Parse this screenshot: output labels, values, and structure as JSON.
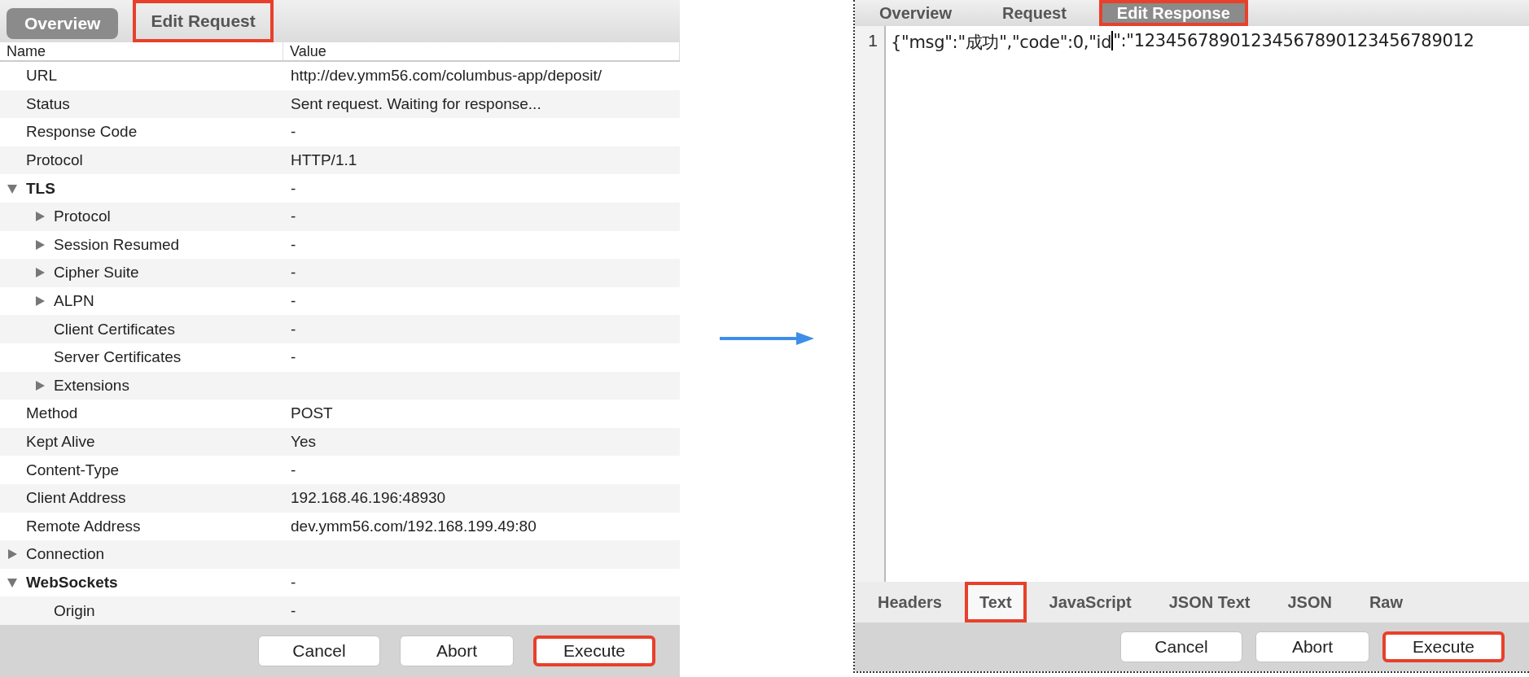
{
  "left_panel": {
    "tabs": [
      {
        "label": "Overview",
        "selected": true,
        "highlighted": false
      },
      {
        "label": "Edit Request",
        "selected": false,
        "highlighted": true
      }
    ],
    "columns": [
      "Name",
      "Value"
    ],
    "rows": [
      {
        "name": "URL",
        "value": "http://dev.ymm56.com/columbus-app/deposit/"
      },
      {
        "name": "Status",
        "value": "Sent request. Waiting for response..."
      },
      {
        "name": "Response Code",
        "value": "-"
      },
      {
        "name": "Protocol",
        "value": "HTTP/1.1"
      },
      {
        "name": "TLS",
        "value": "-",
        "expanded": true,
        "children": [
          {
            "name": "Protocol",
            "value": "-",
            "expanded": false
          },
          {
            "name": "Session Resumed",
            "value": "-",
            "expanded": false
          },
          {
            "name": "Cipher Suite",
            "value": "-",
            "expanded": false
          },
          {
            "name": "ALPN",
            "value": "-",
            "expanded": false
          },
          {
            "name": "Client Certificates",
            "value": "-"
          },
          {
            "name": "Server Certificates",
            "value": "-"
          },
          {
            "name": "Extensions",
            "expanded": false
          }
        ]
      },
      {
        "name": "Method",
        "value": "POST"
      },
      {
        "name": "Kept Alive",
        "value": "Yes"
      },
      {
        "name": "Content-Type",
        "value": "-"
      },
      {
        "name": "Client Address",
        "value": "192.168.46.196:48930"
      },
      {
        "name": "Remote Address",
        "value": "dev.ymm56.com/192.168.199.49:80"
      },
      {
        "name": "Connection",
        "expanded": false
      },
      {
        "name": "WebSockets",
        "value": "-",
        "expanded": true,
        "children": [
          {
            "name": "Origin",
            "value": "-"
          }
        ]
      }
    ],
    "buttons": [
      {
        "label": "Cancel",
        "highlighted": false
      },
      {
        "label": "Abort",
        "highlighted": false
      },
      {
        "label": "Execute",
        "highlighted": true
      }
    ]
  },
  "right_panel": {
    "tabs": [
      {
        "label": "Overview",
        "selected": false,
        "highlighted": false
      },
      {
        "label": "Request",
        "selected": false,
        "highlighted": false
      },
      {
        "label": "Edit Response",
        "selected": true,
        "highlighted": true
      }
    ],
    "editor": {
      "line_number": "1",
      "text_before_cursor": "{\"msg\":\"成功\",\"code\":0,\"id",
      "text_after_cursor": "\":\"12345678901234567890123456789012"
    },
    "view_tabs": [
      {
        "label": "Headers",
        "selected": false,
        "highlighted": false
      },
      {
        "label": "Text",
        "selected": true,
        "highlighted": true
      },
      {
        "label": "JavaScript",
        "selected": false,
        "highlighted": false
      },
      {
        "label": "JSON Text",
        "selected": false,
        "highlighted": false
      },
      {
        "label": "JSON",
        "selected": false,
        "highlighted": false
      },
      {
        "label": "Raw",
        "selected": false,
        "highlighted": false
      }
    ],
    "buttons": [
      {
        "label": "Cancel",
        "highlighted": false
      },
      {
        "label": "Abort",
        "highlighted": false
      },
      {
        "label": "Execute",
        "highlighted": true
      }
    ]
  }
}
